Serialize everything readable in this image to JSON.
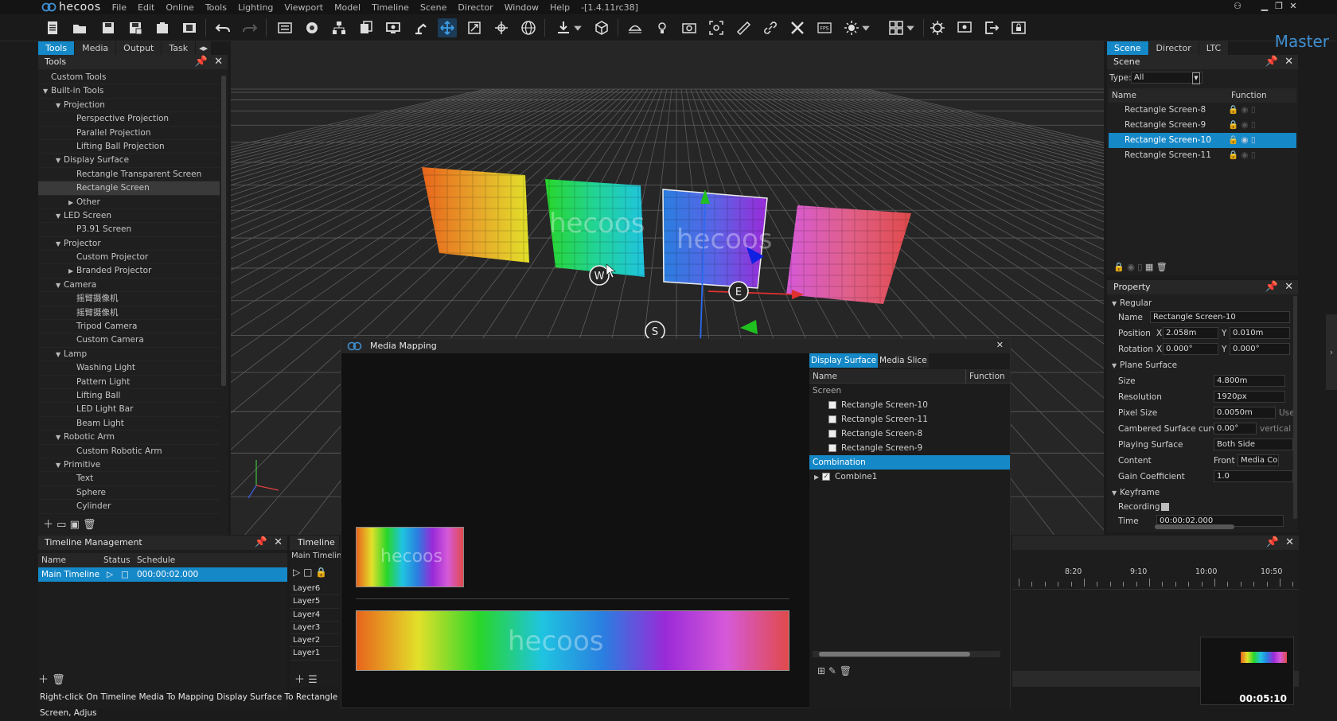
{
  "app": {
    "logo": "hecoos",
    "menu": [
      "File",
      "Edit",
      "Online",
      "Tools",
      "Lighting",
      "Viewport",
      "Model",
      "Timeline",
      "Scene",
      "Director",
      "Window",
      "Help"
    ],
    "version": "-[1.4.11rc38]",
    "mode": "Master"
  },
  "left_tabs": [
    "Tools",
    "Media",
    "Output",
    "Task"
  ],
  "tools_panel": {
    "title": "Tools",
    "tree": [
      {
        "label": "Custom Tools",
        "level": 0,
        "arrow": ""
      },
      {
        "label": "Built-in Tools",
        "level": 0,
        "arrow": "open"
      },
      {
        "label": "Projection",
        "level": 1,
        "arrow": "open"
      },
      {
        "label": "Perspective Projection",
        "level": 2,
        "arrow": ""
      },
      {
        "label": "Parallel Projection",
        "level": 2,
        "arrow": ""
      },
      {
        "label": "Lifting Ball Projection",
        "level": 2,
        "arrow": ""
      },
      {
        "label": "Display Surface",
        "level": 1,
        "arrow": "open"
      },
      {
        "label": "Rectangle Transparent Screen",
        "level": 2,
        "arrow": ""
      },
      {
        "label": "Rectangle Screen",
        "level": 2,
        "arrow": "",
        "selected": true
      },
      {
        "label": "Other",
        "level": 2,
        "arrow": "closed"
      },
      {
        "label": "LED Screen",
        "level": 1,
        "arrow": "open"
      },
      {
        "label": "P3.91 Screen",
        "level": 2,
        "arrow": ""
      },
      {
        "label": "Projector",
        "level": 1,
        "arrow": "open"
      },
      {
        "label": "Custom Projector",
        "level": 2,
        "arrow": ""
      },
      {
        "label": "Branded Projector",
        "level": 2,
        "arrow": "closed"
      },
      {
        "label": "Camera",
        "level": 1,
        "arrow": "open"
      },
      {
        "label": "摇臂摄像机",
        "level": 2,
        "arrow": ""
      },
      {
        "label": "摇臂摄像机",
        "level": 2,
        "arrow": ""
      },
      {
        "label": "Tripod Camera",
        "level": 2,
        "arrow": ""
      },
      {
        "label": "Custom Camera",
        "level": 2,
        "arrow": ""
      },
      {
        "label": "Lamp",
        "level": 1,
        "arrow": "open"
      },
      {
        "label": "Washing Light",
        "level": 2,
        "arrow": ""
      },
      {
        "label": "Pattern Light",
        "level": 2,
        "arrow": ""
      },
      {
        "label": "Lifting Ball",
        "level": 2,
        "arrow": ""
      },
      {
        "label": "LED Light Bar",
        "level": 2,
        "arrow": ""
      },
      {
        "label": "Beam Light",
        "level": 2,
        "arrow": ""
      },
      {
        "label": "Robotic Arm",
        "level": 1,
        "arrow": "open"
      },
      {
        "label": "Custom Robotic Arm",
        "level": 2,
        "arrow": ""
      },
      {
        "label": "Primitive",
        "level": 1,
        "arrow": "open"
      },
      {
        "label": "Text",
        "level": 2,
        "arrow": ""
      },
      {
        "label": "Sphere",
        "level": 2,
        "arrow": ""
      },
      {
        "label": "Cylinder",
        "level": 2,
        "arrow": ""
      }
    ]
  },
  "timeline_mgmt": {
    "title": "Timeline Management",
    "columns": [
      "Name",
      "Status",
      "Schedule"
    ],
    "rows": [
      {
        "name": "Main Timeline",
        "schedule": "000:00:02.000"
      }
    ]
  },
  "timeline": {
    "title": "Timeline",
    "sub": "Main Timeline",
    "layers": [
      "Layer6",
      "Layer5",
      "Layer4",
      "Layer3",
      "Layer2",
      "Layer1"
    ],
    "ticks": [
      "8:20",
      "9:10",
      "10:00",
      "10:50"
    ],
    "clock": "00:05:10"
  },
  "right_tabs": [
    "Scene",
    "Director",
    "LTC"
  ],
  "scene_panel": {
    "title": "Scene",
    "type_label": "Type:",
    "type_value": "All",
    "columns": [
      "Name",
      "Function"
    ],
    "items": [
      "Rectangle Screen-8",
      "Rectangle Screen-9",
      "Rectangle Screen-10",
      "Rectangle Screen-11"
    ],
    "selected_index": 2
  },
  "property_panel": {
    "title": "Property",
    "regular": "Regular",
    "name_label": "Name",
    "name_value": "Rectangle Screen-10",
    "position_label": "Position",
    "pos_x": "2.058m",
    "pos_y": "0.010m",
    "rotation_label": "Rotation",
    "rot_x": "0.000°",
    "rot_y": "0.000°",
    "plane": "Plane Surface",
    "size_label": "Size",
    "size_value": "4.800m",
    "res_label": "Resolution",
    "res_value": "1920px",
    "pixel_label": "Pixel Size",
    "pixel_value": "0.0050m",
    "pixel_use": "Use",
    "curve_label": "Cambered Surface curve",
    "curve_value": "0.00°",
    "curve_vertical": "vertical",
    "playing_label": "Playing Surface",
    "playing_value": "Both Side",
    "content_label": "Content",
    "content_front": "Front",
    "content_value": "Media Co",
    "gain_label": "Gain Coefficient",
    "gain_value": "1.0",
    "keyframe": "Keyframe",
    "recording": "Recording",
    "time_label": "Time",
    "time_value": "00:00:02.000"
  },
  "media_mapping": {
    "title": "Media Mapping",
    "tabs": [
      "Display Surface",
      "Media Slice"
    ],
    "columns": [
      "Name",
      "Function"
    ],
    "group_screen": "Screen",
    "screens": [
      "Rectangle Screen-10",
      "Rectangle Screen-11",
      "Rectangle Screen-8",
      "Rectangle Screen-9"
    ],
    "group_combination": "Combination",
    "combination": "Combine1",
    "thumb_text": "hecoos"
  },
  "viewport_labels": {
    "w": "W",
    "e": "E",
    "s": "S",
    "watermark": "hecoos"
  },
  "status_text": "Right-click On Timeline Media To Mapping Display Surface To Rectangle Screen, Adjus"
}
